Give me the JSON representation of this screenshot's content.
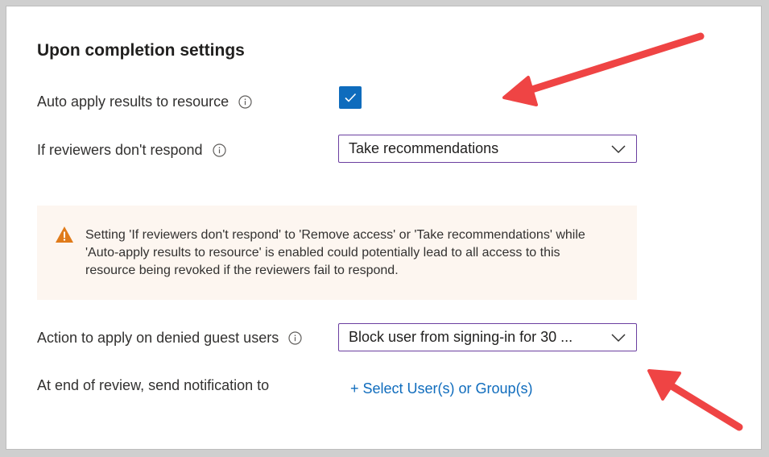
{
  "section": {
    "title": "Upon completion settings"
  },
  "auto_apply": {
    "label": "Auto apply results to resource",
    "checked": true
  },
  "no_response": {
    "label": "If reviewers don't respond",
    "selected": "Take recommendations"
  },
  "warning": {
    "text": "Setting 'If reviewers don't respond' to 'Remove access' or 'Take recommendations' while 'Auto-apply results to resource' is enabled could potentially lead to all access to this resource being revoked if the reviewers fail to respond."
  },
  "denied_guests": {
    "label": "Action to apply on denied guest users",
    "selected": "Block user from signing-in for 30 ..."
  },
  "notification": {
    "label": "At end of review, send notification to",
    "link": "+ Select User(s) or Group(s)"
  },
  "colors": {
    "accent": "#0f6cbd",
    "dropdown_border": "#6b3fa0",
    "warning_bg": "#fdf6f0",
    "warning_icon": "#e07b1a",
    "annotation_arrow": "#ef4444"
  },
  "icons": [
    "info-icon",
    "checkmark-icon",
    "chevron-down-icon",
    "warning-icon",
    "annotation-arrow"
  ]
}
